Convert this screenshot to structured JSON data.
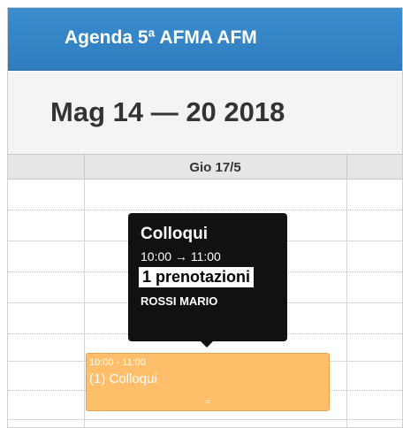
{
  "header": {
    "title": "Agenda 5ª AFMA AFM"
  },
  "toolbar": {
    "range": "Mag 14 — 20 2018"
  },
  "calendar": {
    "day_header": "Gio 17/5"
  },
  "event": {
    "time": "10:00 - 11:00",
    "label": "(1) Colloqui",
    "resize_handle": "=",
    "color": "#ffbe6a"
  },
  "tooltip": {
    "title": "Colloqui",
    "time": "10:00 → 11:00",
    "bookings": "1 prenotazioni",
    "name": "ROSSI MARIO"
  },
  "colors": {
    "header": "#2f7cbf",
    "tooltip_bg": "#111111"
  }
}
